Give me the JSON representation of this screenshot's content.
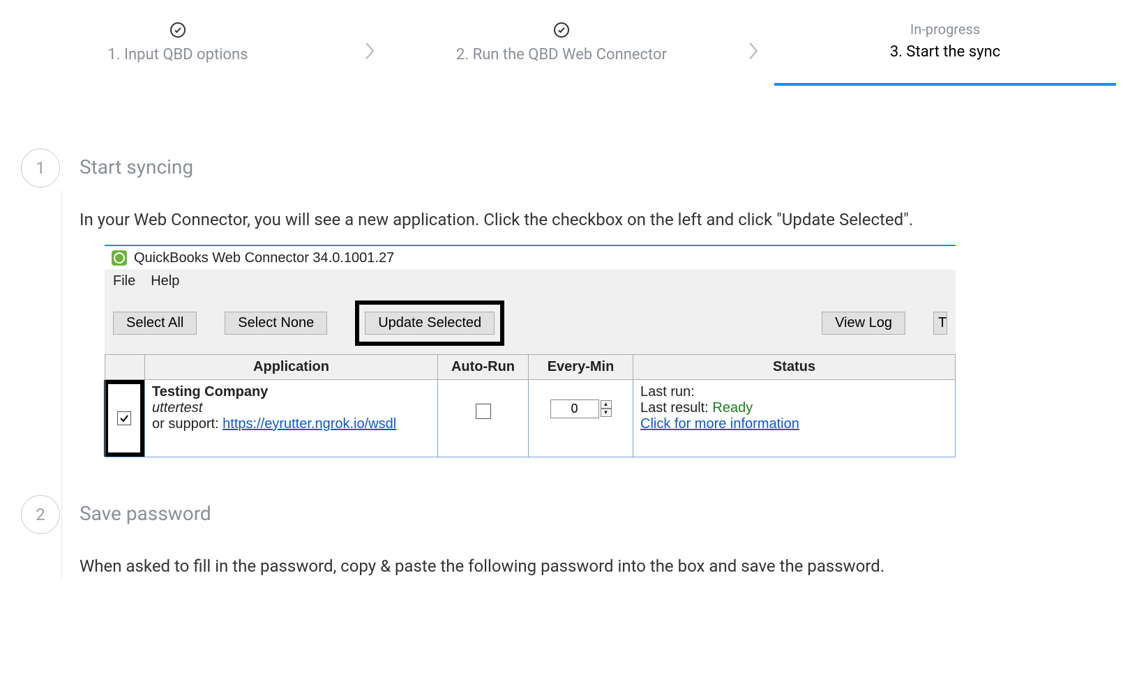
{
  "stepper": {
    "steps": [
      {
        "title": "1. Input QBD options",
        "completed": true
      },
      {
        "title": "2. Run the QBD Web Connector",
        "completed": true
      },
      {
        "status": "In-progress",
        "title": "3. Start the sync",
        "active": true
      }
    ]
  },
  "substep1": {
    "num": "1",
    "title": "Start syncing",
    "body": "In your Web Connector, you will see a new application. Click the checkbox on the left and click \"Update Selected\"."
  },
  "qb": {
    "title": "QuickBooks Web Connector 34.0.1001.27",
    "menu_file": "File",
    "menu_help": "Help",
    "btn_select_all": "Select All",
    "btn_select_none": "Select None",
    "btn_update_selected": "Update Selected",
    "btn_view_log": "View Log",
    "col_app": "Application",
    "col_autorun": "Auto-Run",
    "col_everymin": "Every-Min",
    "col_status": "Status",
    "row": {
      "company": "Testing Company",
      "sub": "uttertest",
      "support_prefix": "or support: ",
      "support_link": "https://eyrutter.ngrok.io/wsdl",
      "every_min": "0",
      "last_run_label": "Last run:",
      "last_result_label": "Last result: ",
      "last_result_value": "Ready",
      "more_info": "Click for more information"
    }
  },
  "substep2": {
    "num": "2",
    "title": "Save password",
    "body": "When asked to fill in the password, copy & paste the following password into the box and save the password."
  }
}
